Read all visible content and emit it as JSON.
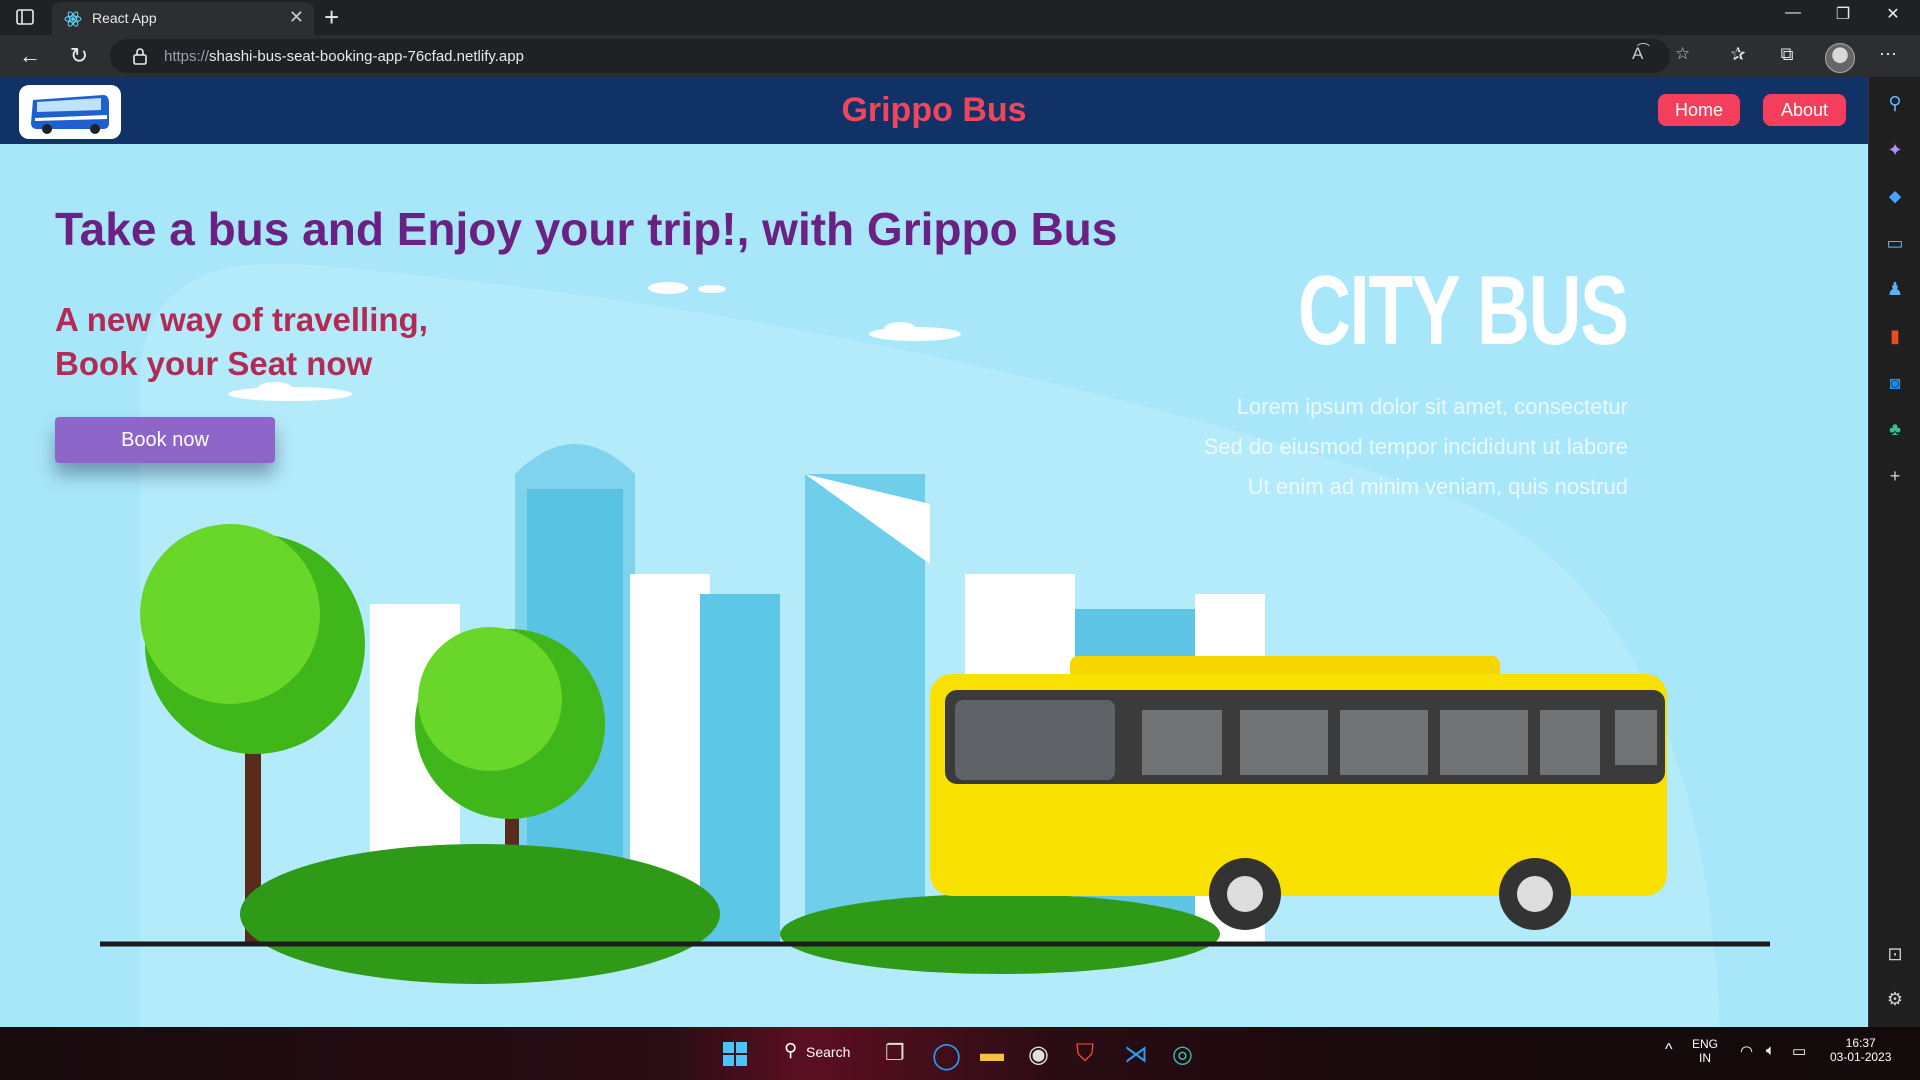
{
  "browser": {
    "tab_title": "React App",
    "url_protocol": "https://",
    "url_host": "shashi-bus-seat-booking-app-76cfad.netlify.app"
  },
  "site": {
    "brand": "Grippo Bus",
    "nav": [
      {
        "label": "Home"
      },
      {
        "label": "About"
      }
    ]
  },
  "hero": {
    "headline": "Take a bus and Enjoy your trip!, with Grippo Bus",
    "subline_1": "A new way of travelling,",
    "subline_2": "Book your Seat now",
    "cta": "Book now",
    "image_title": "CITY BUS",
    "image_lines": [
      "Lorem ipsum dolor sit amet, consectetur",
      "Sed do eiusmod tempor incididunt ut labore",
      "Ut enim ad minim veniam, quis nostrud"
    ]
  },
  "taskbar": {
    "search_label": "Search",
    "lang_1": "ENG",
    "lang_2": "IN",
    "time": "16:37",
    "date": "03-01-2023"
  },
  "colors": {
    "navbar": "#113266",
    "brand": "#f0465d",
    "headline": "#6a2181",
    "subline": "#b22b55",
    "cta": "#8e65c9",
    "page_bg": "#a8e7fa"
  }
}
